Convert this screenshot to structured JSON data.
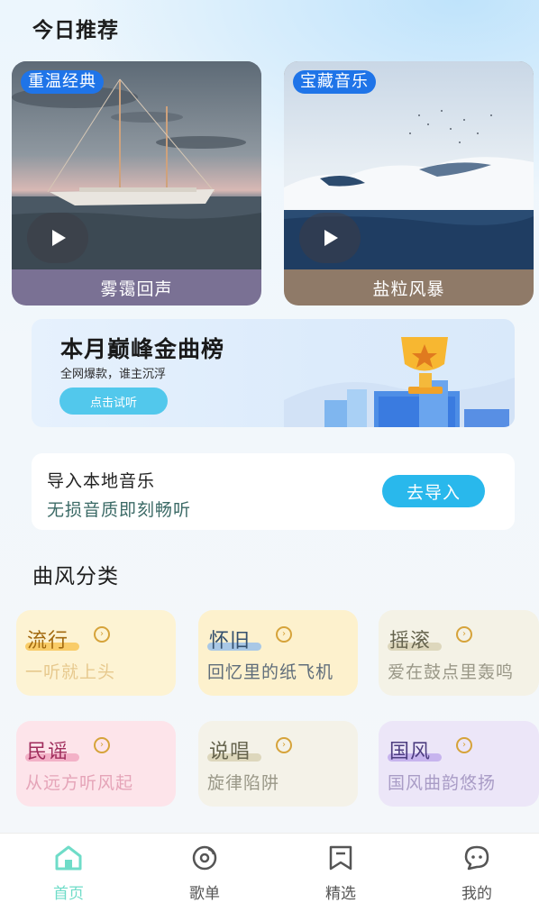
{
  "recommend": {
    "title": "今日推荐",
    "cards": [
      {
        "tag": "重温经典",
        "caption": "雾霭回声"
      },
      {
        "tag": "宝藏音乐",
        "caption": "盐粒风暴"
      }
    ]
  },
  "banner": {
    "title": "本月巅峰金曲榜",
    "subtitle": "全网爆款，谁主沉浮",
    "button": "点击试听"
  },
  "import_card": {
    "title": "导入本地音乐",
    "subtitle": "无损音质即刻畅听",
    "button": "去导入"
  },
  "genres": {
    "title": "曲风分类",
    "items": [
      {
        "name": "流行",
        "desc": "一听就上头"
      },
      {
        "name": "怀旧",
        "desc": "回忆里的纸飞机"
      },
      {
        "name": "摇滚",
        "desc": "爱在鼓点里轰鸣"
      },
      {
        "name": "民谣",
        "desc": "从远方听风起"
      },
      {
        "name": "说唱",
        "desc": "旋律陷阱"
      },
      {
        "name": "国风",
        "desc": "国风曲韵悠扬"
      }
    ]
  },
  "tabbar": {
    "items": [
      {
        "label": "首页",
        "icon": "home-icon",
        "active": true
      },
      {
        "label": "歌单",
        "icon": "disc-icon",
        "active": false
      },
      {
        "label": "精选",
        "icon": "bookmark-icon",
        "active": false
      },
      {
        "label": "我的",
        "icon": "chat-face-icon",
        "active": false
      }
    ]
  },
  "colors": {
    "accent": "#29b8ec",
    "tag_blue": "#1f74e8",
    "active_tab": "#6fdcc8"
  }
}
